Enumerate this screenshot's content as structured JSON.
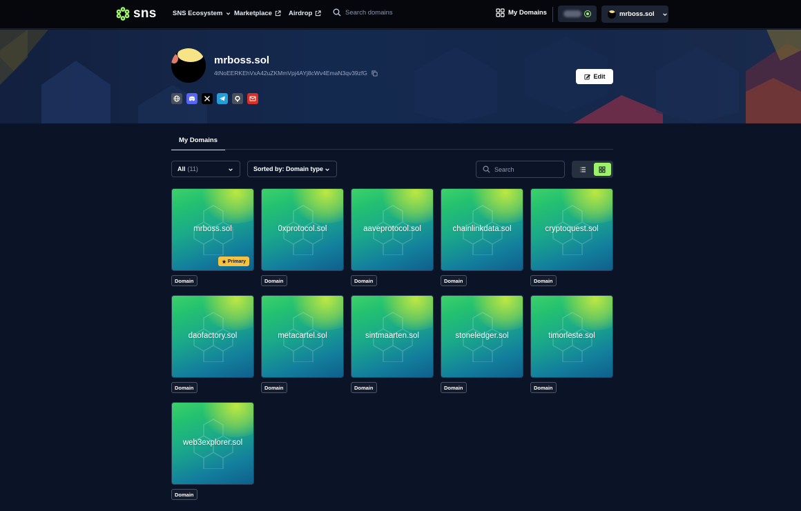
{
  "nav": {
    "brand": "sns",
    "ecosystem": "SNS Ecosystem",
    "marketplace": "Marketplace",
    "airdrop": "Airdrop",
    "search_placeholder": "Search domains",
    "my_domains": "My Domains",
    "account": "mrboss.sol",
    "accent_color": "#9ef26b"
  },
  "profile": {
    "name": "mrboss.sol",
    "address": "4tNoEERKEhVxA42uZKMmVpj4AYj8cWv4EmaN3qv39zfG",
    "edit_label": "Edit",
    "socials": [
      "globe-icon",
      "discord-icon",
      "x-icon",
      "telegram-icon",
      "github-icon",
      "email-icon"
    ]
  },
  "tabs": {
    "active": "My Domains"
  },
  "controls": {
    "filter_label": "All",
    "filter_count": "(11)",
    "sort_label": "Sorted by: Domain type",
    "search_placeholder": "Search"
  },
  "domains": [
    {
      "name": "mrboss.sol",
      "type": "Domain",
      "primary": "Primary"
    },
    {
      "name": "0xprotocol.sol",
      "type": "Domain"
    },
    {
      "name": "aaveprotocol.sol",
      "type": "Domain"
    },
    {
      "name": "chainlinkdata.sol",
      "type": "Domain"
    },
    {
      "name": "cryptoquest.sol",
      "type": "Domain"
    },
    {
      "name": "daofactory.sol",
      "type": "Domain"
    },
    {
      "name": "metacartel.sol",
      "type": "Domain"
    },
    {
      "name": "sintmaarten.sol",
      "type": "Domain"
    },
    {
      "name": "stoneledger.sol",
      "type": "Domain"
    },
    {
      "name": "timorleste.sol",
      "type": "Domain"
    },
    {
      "name": "web3explorer.sol",
      "type": "Domain"
    }
  ]
}
